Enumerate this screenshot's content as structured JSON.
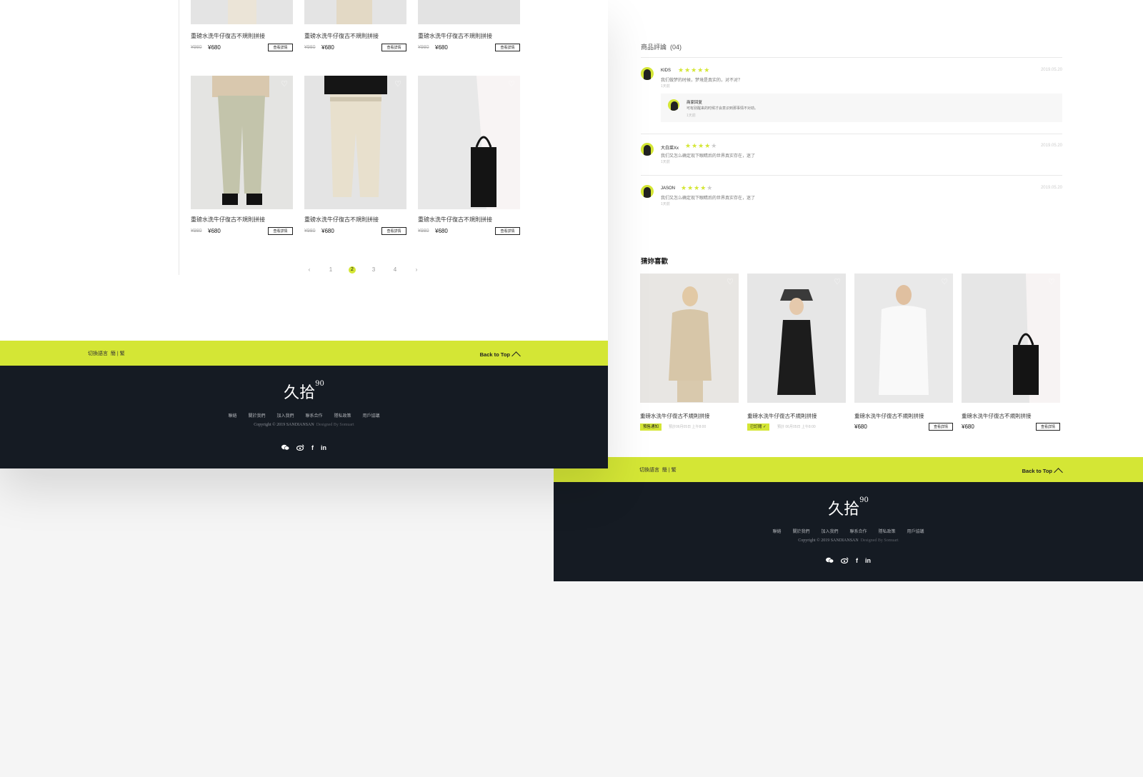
{
  "left": {
    "top_products": [
      {
        "name": "重磅水洗牛仔復古不規則拼接",
        "old_price": "¥980",
        "price": "¥680",
        "button": "查看詳情"
      },
      {
        "name": "重磅水洗牛仔復古不規則拼接",
        "old_price": "¥980",
        "price": "¥680",
        "button": "查看詳情"
      },
      {
        "name": "重磅水洗牛仔復古不規則拼接",
        "old_price": "¥980",
        "price": "¥680",
        "button": "查看詳情"
      }
    ],
    "products": [
      {
        "name": "重磅水洗牛仔復古不規則拼接",
        "old_price": "¥980",
        "price": "¥680",
        "button": "查看詳情"
      },
      {
        "name": "重磅水洗牛仔復古不規則拼接",
        "old_price": "¥980",
        "price": "¥680",
        "button": "查看詳情"
      },
      {
        "name": "重磅水洗牛仔復古不規則拼接",
        "old_price": "¥980",
        "price": "¥680",
        "button": "查看詳情"
      }
    ],
    "pagination": {
      "prev": "‹",
      "pages": [
        "1",
        "2",
        "3",
        "4"
      ],
      "current": "2",
      "next": "›"
    }
  },
  "bar": {
    "lang_label": "切換語言",
    "lang_options": "簡 | 繁",
    "back_to_top": "Back to Top"
  },
  "footer": {
    "logo": "久拾",
    "logo_sup": "90",
    "links": [
      "聯絡",
      "關於我們",
      "加入我們",
      "聯系合作",
      "隱私政策",
      "用戶協議"
    ],
    "copyright": "Copyright © 2019 SANDIANSAN",
    "designed_by": "Designed By Somuart",
    "social": [
      "wechat-icon",
      "weibo-icon",
      "facebook-icon",
      "linkedin-icon"
    ]
  },
  "reviews": {
    "title": "商品評論",
    "count": "(04)",
    "items": [
      {
        "user": "KIDS",
        "stars": 5,
        "text": "我们做梦的时候，梦境是真实的，对不对？",
        "time": "1天前",
        "date": "2019.05.20",
        "reply": {
          "user": "商家回复",
          "text": "可有别醒来的时候才会意识到那事情不对劲。",
          "time": "1天前"
        }
      },
      {
        "user": "大白菜Xx",
        "stars": 4,
        "text": "我们又怎么确定现下眼睛后的世界真实存在，迷了",
        "time": "1天前",
        "date": "2019.05.20"
      },
      {
        "user": "JASON",
        "stars": 4,
        "text": "我们又怎么确定现下眼睛后的世界真实存在，迷了",
        "time": "1天前",
        "date": "2019.05.20"
      }
    ]
  },
  "recommend": {
    "title": "猜妳喜歡",
    "items": [
      {
        "name": "重磅水洗牛仔復古不規則拼接",
        "tag": "預售通知",
        "note": "預計06月05日 上午8:00"
      },
      {
        "name": "重磅水洗牛仔復古不規則拼接",
        "tag": "已訂閱 ✓",
        "note": "預計 06月05日 上午8:00"
      },
      {
        "name": "重磅水洗牛仔復古不規則拼接",
        "price": "¥680",
        "button": "查看詳情"
      },
      {
        "name": "重磅水洗牛仔復古不規則拼接",
        "price": "¥680",
        "button": "查看詳情"
      }
    ]
  },
  "colors": {
    "accent": "#d4e635",
    "footer_bg": "#151b23"
  }
}
